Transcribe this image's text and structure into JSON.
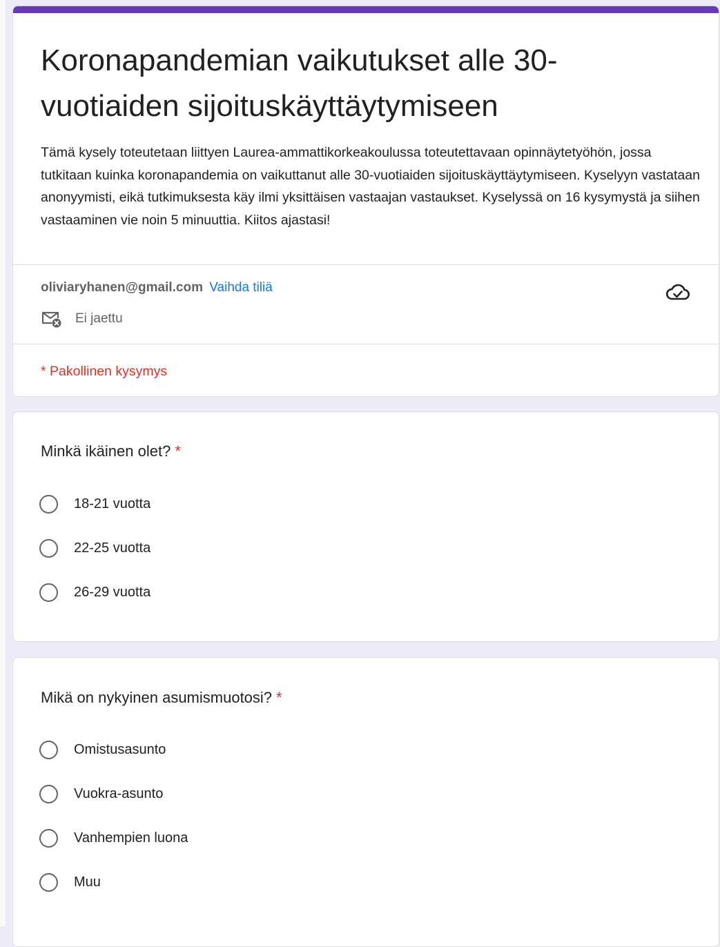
{
  "form": {
    "title": "Koronapandemian vaikutukset alle 30-vuotiaiden sijoituskäyttäytymiseen",
    "description": "Tämä kysely toteutetaan liittyen Laurea-ammattikorkeakoulussa toteutettavaan opinnäytetyöhön, jossa tutkitaan kuinka koronapandemia on vaikuttanut alle 30-vuotiaiden sijoituskäyttäytymiseen. Kyselyyn vastataan anonyymisti, eikä tutkimuksesta käy ilmi yksittäisen vastaajan vastaukset. Kyselyssä on 16 kysymystä ja siihen vastaaminen vie noin 5 minuuttia. Kiitos ajastasi!",
    "account_email": "oliviaryhanen@gmail.com",
    "switch_account_label": "Vaihda tiliä",
    "share_status": "Ei jaettu",
    "required_note": "* Pakollinen kysymys",
    "required_marker": "*",
    "accent_color": "#673ab7",
    "icons": {
      "save_status": "cloud-check-icon",
      "email": "email-not-shared-icon"
    }
  },
  "questions": [
    {
      "title": "Minkä ikäinen olet?",
      "required": true,
      "options": [
        "18-21 vuotta",
        "22-25 vuotta",
        "26-29 vuotta"
      ]
    },
    {
      "title": "Mikä on nykyinen asumismuotosi?",
      "required": true,
      "options": [
        "Omistusasunto",
        "Vuokra-asunto",
        "Vanhempien luona",
        "Muu"
      ]
    }
  ]
}
